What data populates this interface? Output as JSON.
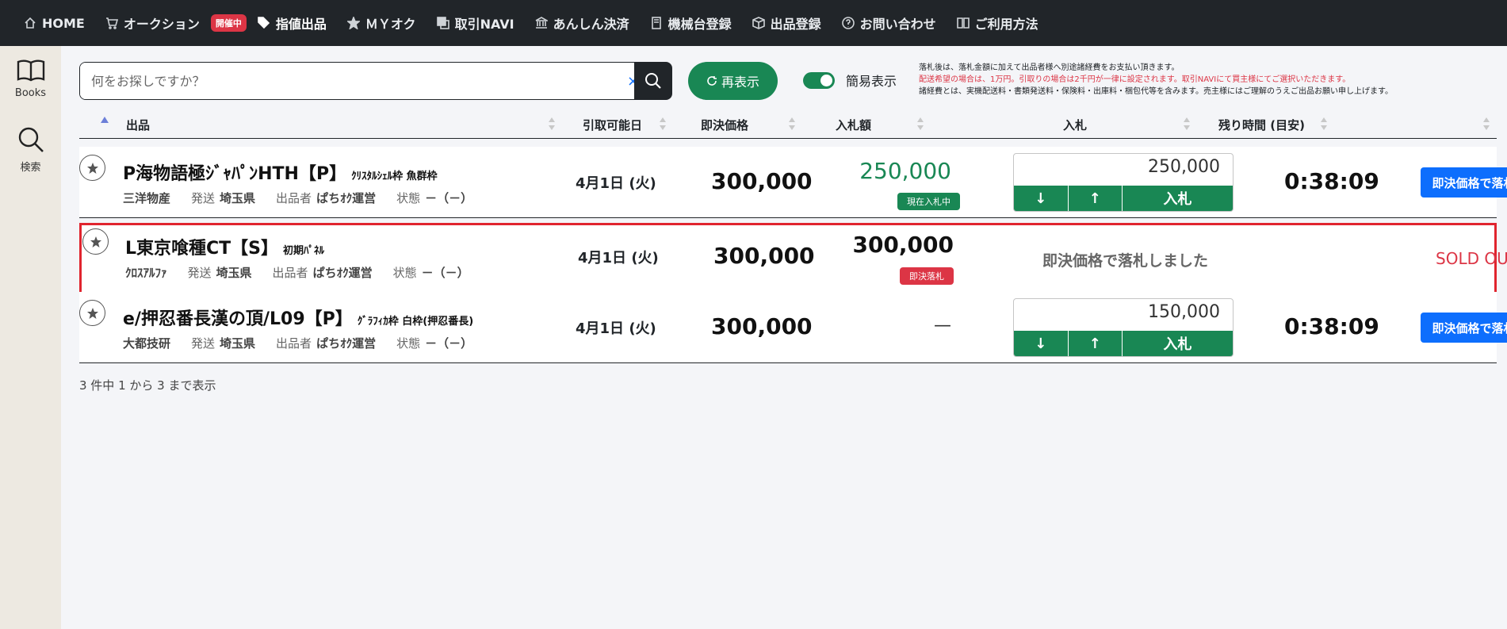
{
  "nav": {
    "items": [
      {
        "label": "HOME",
        "icon": "home-icon"
      },
      {
        "label": "オークション",
        "icon": "cart-icon"
      },
      {
        "label": "指値出品",
        "icon": "tags-icon",
        "active": true
      },
      {
        "label": "ＭＹオク",
        "icon": "star-icon"
      },
      {
        "label": "取引NAVI",
        "icon": "copy-icon"
      },
      {
        "label": "あんしん決済",
        "icon": "bank-icon"
      },
      {
        "label": "機械台登録",
        "icon": "book-icon"
      },
      {
        "label": "出品登録",
        "icon": "box-icon"
      },
      {
        "label": "お問い合わせ",
        "icon": "question-icon"
      },
      {
        "label": "ご利用方法",
        "icon": "guide-icon"
      }
    ],
    "live_badge": "開催中"
  },
  "sidebar": {
    "books_label": "Books",
    "search_label": "検索"
  },
  "search": {
    "placeholder": "何をお探しですか？",
    "clear": "×"
  },
  "toolbar": {
    "refresh_label": "再表示",
    "simple_view_label": "簡易表示",
    "simple_view_on": true
  },
  "notices": {
    "line1": "落札後は、落札金額に加えて出品者様へ別途諸経費をお支払い頂きます。",
    "line2": "配送希望の場合は、1万円。引取りの場合は2千円が一律に設定されます。取引NAVIにて買主様にてご選択いただきます。",
    "line3": "諸経費とは、実機配送料・書類発送料・保険料・出庫料・梱包代等を含みます。売主様にはご理解のうえご出品お願い申し上げます。",
    "line2_color": "#dc3545"
  },
  "table": {
    "headers": {
      "item": "出品",
      "pickup_date": "引取可能日",
      "buy_now_price": "即決価格",
      "bid_amount": "入札額",
      "bid": "入札",
      "remaining": "残り時間 (目安)"
    },
    "rows": [
      {
        "title": "P海物語極ｼﾞｬﾊﾟﾝHTH【P】",
        "subtitle": "ｸﾘｽﾀﾙｼｪﾙ枠 魚群枠",
        "maker": "三洋物産",
        "ship_label": "発送",
        "ship_pref": "埼玉県",
        "seller_label": "出品者",
        "seller": "ぱちｵｸ運営",
        "state_label": "状態",
        "state": "－（－）",
        "date": "4月1日 (火)",
        "price": "300,000",
        "bid_amount": "250,000",
        "bid_tag": "現在入札中",
        "bid_input": "250,000",
        "down": "↓",
        "up": "↑",
        "bid_button": "入札",
        "timer": "0:38:09",
        "buy_now": "即決価格で落札"
      },
      {
        "title": "L東京喰種CT【S】",
        "subtitle": "初期ﾊﾟﾈﾙ",
        "maker": "ｸﾛｽｱﾙﾌｧ",
        "ship_label": "発送",
        "ship_pref": "埼玉県",
        "seller_label": "出品者",
        "seller": "ぱちｵｸ運営",
        "state_label": "状態",
        "state": "－（－）",
        "date": "4月1日 (火)",
        "price": "300,000",
        "bid_amount": "300,000",
        "bid_tag": "即決落札",
        "sold_message": "即決価格で落札しました",
        "sold_out": "SOLD OUT"
      },
      {
        "title": "e/押忍番長漢の頂/L09【P】",
        "subtitle": "ｸﾞﾗﾌｨｶ枠 白枠(押忍番長)",
        "maker": "大都技研",
        "ship_label": "発送",
        "ship_pref": "埼玉県",
        "seller_label": "出品者",
        "seller": "ぱちｵｸ運営",
        "state_label": "状態",
        "state": "－（－）",
        "date": "4月1日 (火)",
        "price": "300,000",
        "bid_amount": "—",
        "bid_input": "150,000",
        "down": "↓",
        "up": "↑",
        "bid_button": "入札",
        "timer": "0:38:09",
        "buy_now": "即決価格で落札"
      }
    ]
  },
  "footer": {
    "count_text": "3 件中 1 から 3 まで表示"
  },
  "colors": {
    "green": "#198754",
    "blue": "#0d6efd",
    "red": "#dc3545",
    "dark": "#212529"
  }
}
